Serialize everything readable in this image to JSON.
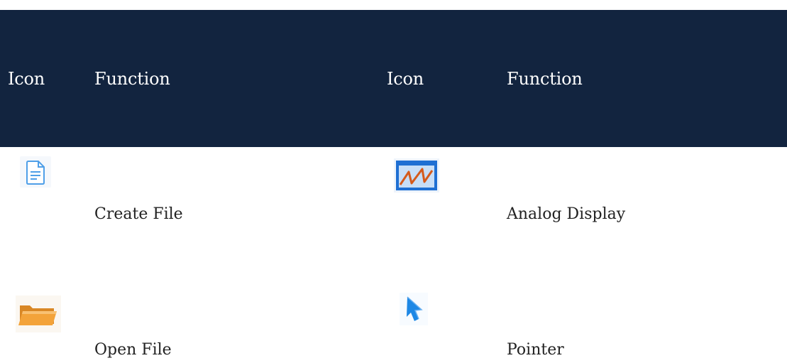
{
  "table": {
    "headers": [
      "Icon",
      "Function",
      "Icon",
      "Function"
    ],
    "rows": [
      {
        "left_icon": "document-file-icon",
        "left_function": "Create File",
        "right_icon": "analog-display-icon",
        "right_function": "Analog Display"
      },
      {
        "left_icon": "open-folder-icon",
        "left_function": "Open File",
        "right_icon": "pointer-cursor-icon",
        "right_function": "Pointer"
      }
    ]
  },
  "colors": {
    "header_bg": "#12243f",
    "header_text": "#ffffff",
    "body_text": "#222222",
    "icon_blue": "#1e88e5",
    "icon_orange": "#f29a2e"
  }
}
